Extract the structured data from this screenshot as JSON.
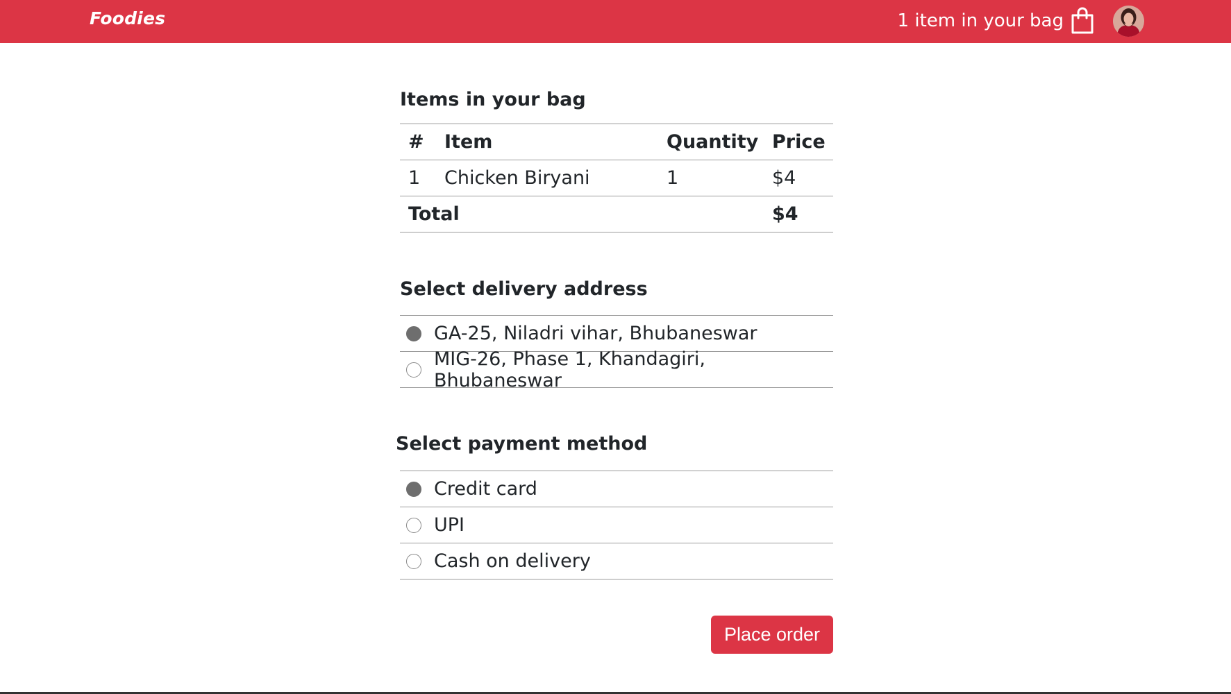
{
  "navbar": {
    "brand": "Foodies",
    "bag_text": "1 item in your bag",
    "bag_icon": "shopping-bag-icon",
    "avatar_icon": "user-avatar",
    "color": "#dc3545"
  },
  "bag": {
    "title": "Items in your bag",
    "columns": [
      "#",
      "Item",
      "Quantity",
      "Price"
    ],
    "rows": [
      {
        "num": "1",
        "item": "Chicken Biryani",
        "quantity": "1",
        "price": "$4"
      }
    ],
    "total_label": "Total",
    "total_value": "$4"
  },
  "address": {
    "title": "Select delivery address",
    "options": [
      {
        "label": "GA-25, Niladri vihar, Bhubaneswar",
        "selected": true
      },
      {
        "label": "MIG-26, Phase 1, Khandagiri, Bhubaneswar",
        "selected": false
      }
    ]
  },
  "payment": {
    "title": "Select payment method",
    "options": [
      {
        "label": "Credit card",
        "selected": true
      },
      {
        "label": "UPI",
        "selected": false
      },
      {
        "label": "Cash on delivery",
        "selected": false
      }
    ]
  },
  "actions": {
    "place_order": "Place order"
  }
}
